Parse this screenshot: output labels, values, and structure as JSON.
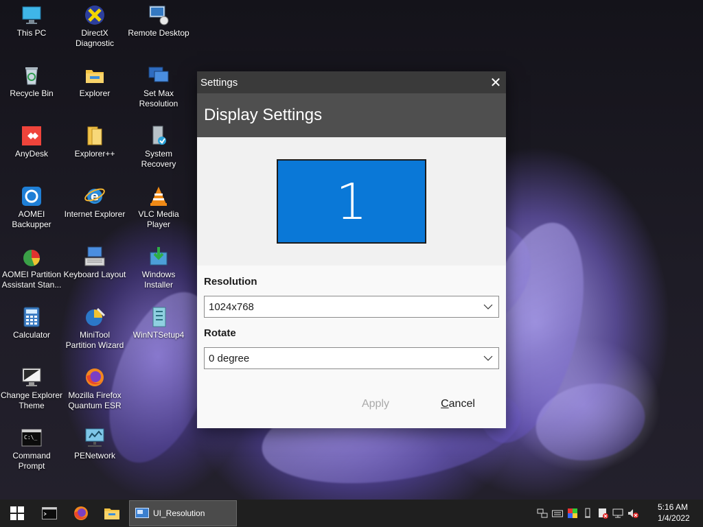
{
  "desktop": {
    "icons": [
      {
        "label": "This PC",
        "icon": "this-pc-icon"
      },
      {
        "label": "DirectX\nDiagnostic",
        "icon": "directx-icon"
      },
      {
        "label": "Remote Desktop",
        "icon": "remote-desktop-icon"
      },
      {
        "label": "Recycle Bin",
        "icon": "recycle-bin-icon"
      },
      {
        "label": "Explorer",
        "icon": "folder-icon"
      },
      {
        "label": "Set Max\nResolution",
        "icon": "set-resolution-icon"
      },
      {
        "label": "AnyDesk",
        "icon": "anydesk-icon"
      },
      {
        "label": "Explorer++",
        "icon": "explorerpp-icon"
      },
      {
        "label": "System Recovery",
        "icon": "system-recovery-icon"
      },
      {
        "label": "AOMEI\nBackupper",
        "icon": "aomei-backupper-icon"
      },
      {
        "label": "Internet Explorer",
        "icon": "internet-explorer-icon"
      },
      {
        "label": "VLC Media\nPlayer",
        "icon": "vlc-icon"
      },
      {
        "label": "AOMEI Partition\nAssistant Stan...",
        "icon": "aomei-partition-icon"
      },
      {
        "label": "Keyboard Layout",
        "icon": "keyboard-icon"
      },
      {
        "label": "Windows\nInstaller",
        "icon": "windows-installer-icon"
      },
      {
        "label": "Calculator",
        "icon": "calculator-icon"
      },
      {
        "label": "MiniTool\nPartition Wizard",
        "icon": "minitool-icon"
      },
      {
        "label": "WinNTSetup4",
        "icon": "winntsetup-icon"
      },
      {
        "label": "Change Explorer\nTheme",
        "icon": "monitor-theme-icon"
      },
      {
        "label": "Mozilla Firefox\nQuantum ESR",
        "icon": "firefox-icon"
      },
      {
        "label": "Command\nPrompt",
        "icon": "command-prompt-icon"
      },
      {
        "label": "PENetwork",
        "icon": "network-icon"
      }
    ]
  },
  "window": {
    "title": "Settings",
    "close_glyph": "✕",
    "header": "Display Settings",
    "monitor_number": "1",
    "resolution_label": "Resolution",
    "resolution_value": "1024x768",
    "rotate_label": "Rotate",
    "rotate_value": "0 degree",
    "apply_label": "Apply",
    "cancel_first": "C",
    "cancel_rest": "ancel"
  },
  "taskbar": {
    "active_window": "UI_Resolution",
    "time": "5:16 AM",
    "date": "1/4/2022"
  },
  "colors": {
    "monitor_blue": "#0a78d7",
    "titlebar": "#3a3a3a",
    "header_band": "#4f4f4f",
    "taskbar": "#1f1f1f"
  }
}
